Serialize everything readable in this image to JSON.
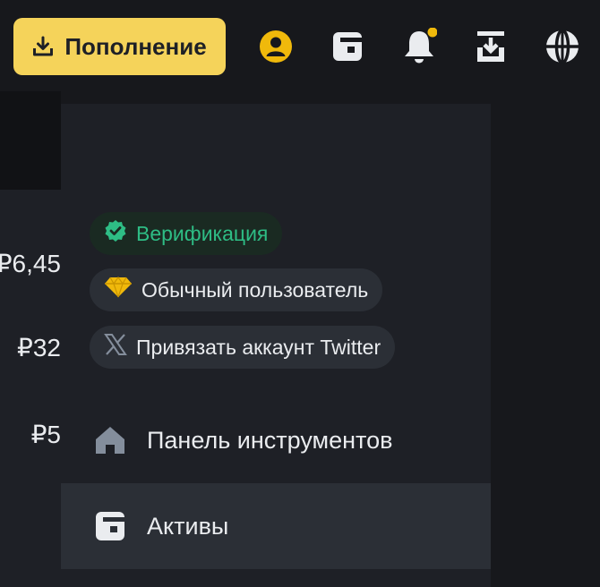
{
  "header": {
    "deposit_label": "Пополнение",
    "icons": [
      "user-icon",
      "wallet-icon",
      "bell-icon",
      "download-icon",
      "globe-icon"
    ],
    "notification_dot_color": "#f0b90b",
    "accent_color": "#f5d35a"
  },
  "background_balances": [
    "₽6,45",
    "₽32",
    "₽5"
  ],
  "dropdown": {
    "badges": {
      "verification": "Верификация",
      "user_level": "Обычный пользователь",
      "twitter": "Привязать аккаунт Twitter"
    },
    "menu": [
      {
        "label": "Панель инструментов",
        "icon": "home-icon"
      },
      {
        "label": "Активы",
        "icon": "wallet-icon"
      }
    ],
    "verified_color": "#2ebd85"
  }
}
